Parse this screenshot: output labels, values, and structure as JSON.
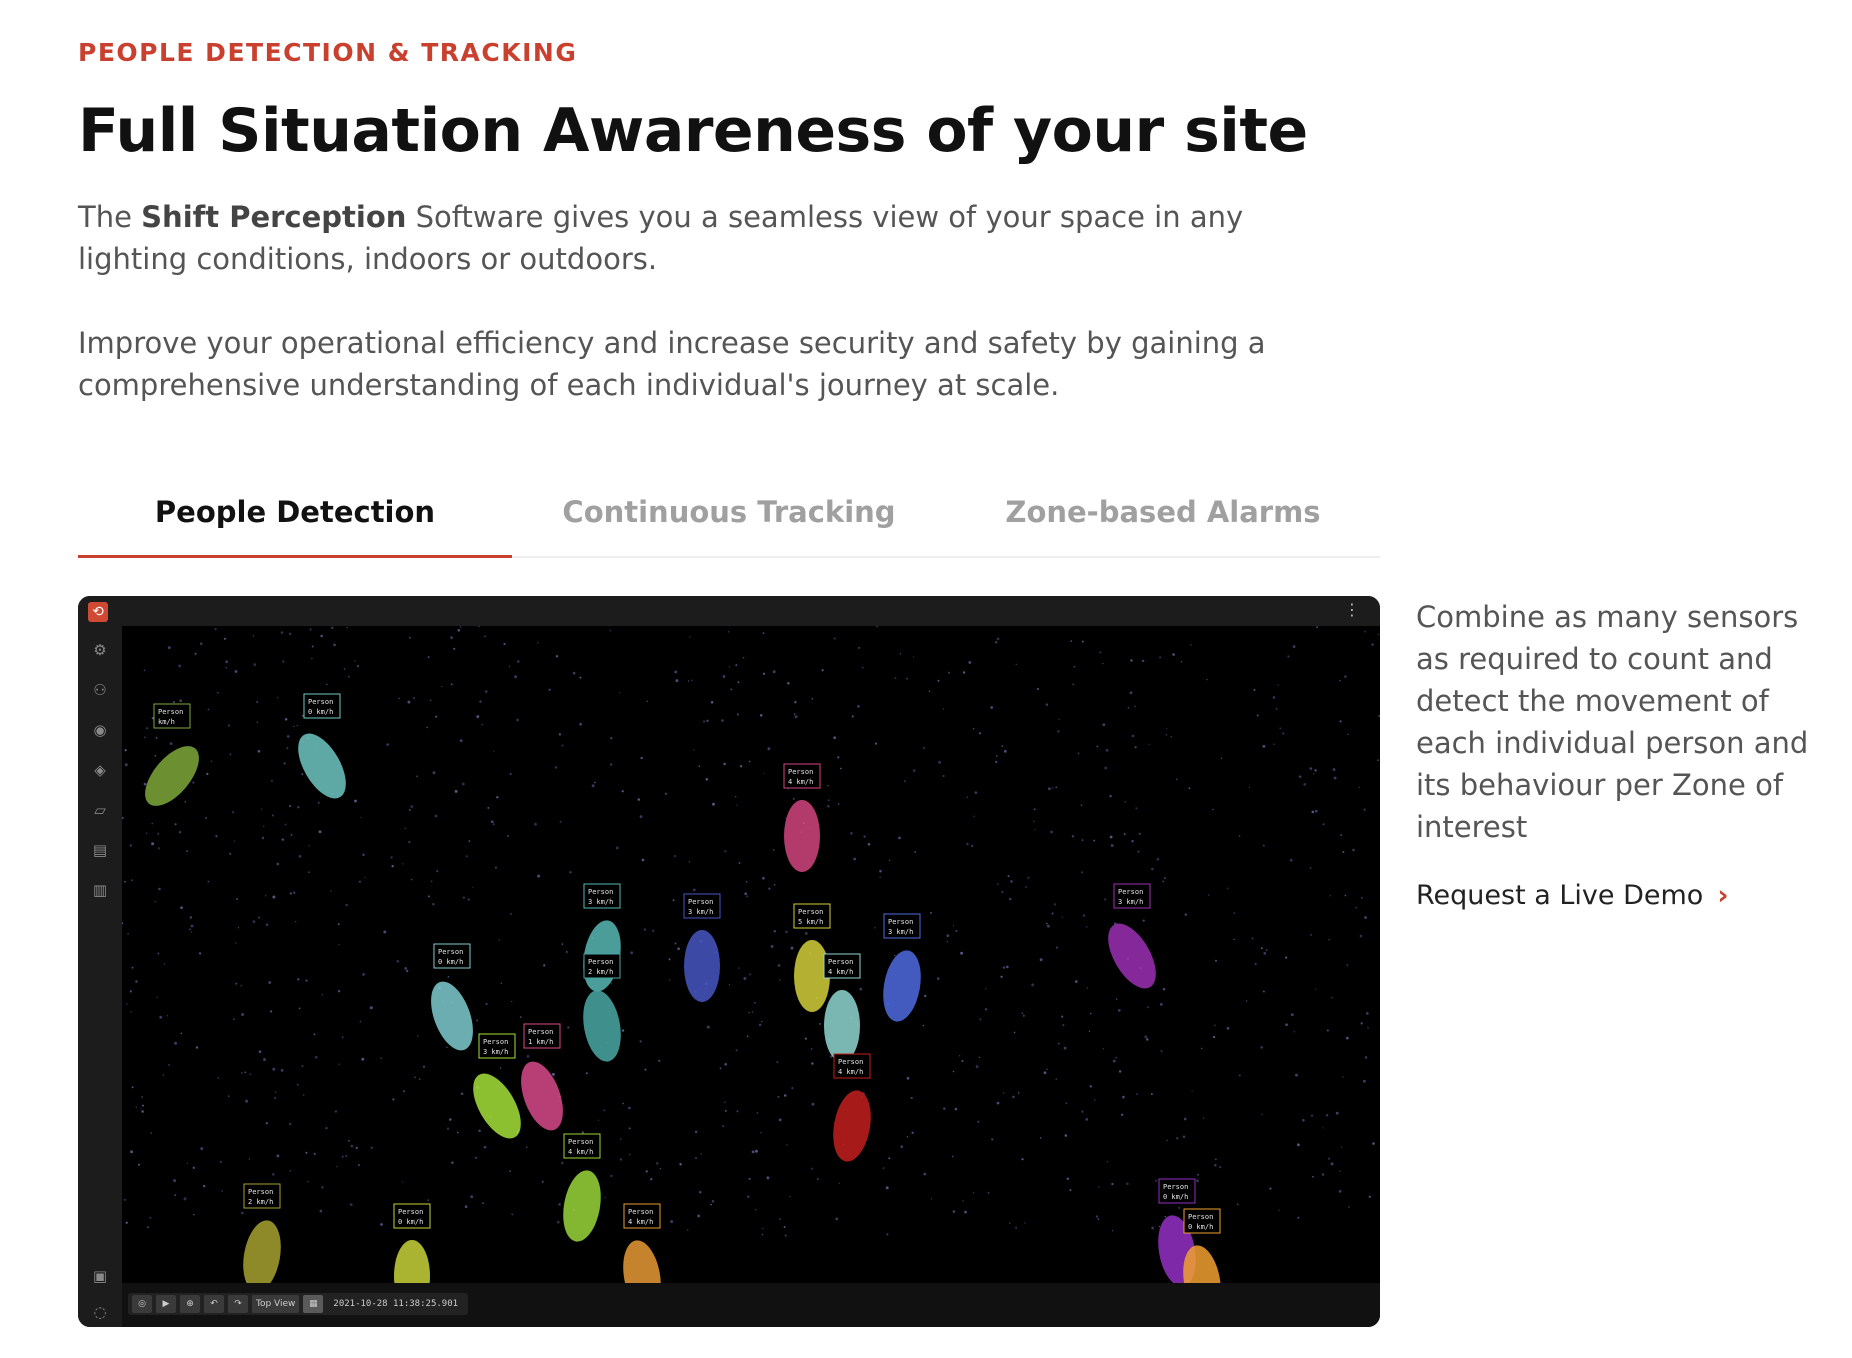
{
  "eyebrow": "PEOPLE DETECTION & TRACKING",
  "headline": "Full Situation Awareness of your site",
  "intro": {
    "prefix": "The ",
    "brand": "Shift Perception",
    "suffix": " Software gives you a seamless view of your space in any lighting conditions, indoors or outdoors."
  },
  "intro2": "Improve your operational efficiency and increase security and safety by gaining a comprehensive understanding of each individual's journey at scale.",
  "tabs": [
    {
      "label": "People Detection",
      "active": true
    },
    {
      "label": "Continuous Tracking",
      "active": false
    },
    {
      "label": "Zone-based Alarms",
      "active": false
    }
  ],
  "viewer": {
    "menu_icon": "kebab-icon",
    "sidebar_icons": [
      "gear-icon",
      "network-icon",
      "sensor-icon",
      "layers-icon",
      "zone-edit-icon",
      "document-icon",
      "map-icon",
      "book-icon",
      "chat-icon"
    ],
    "people": [
      {
        "label": "Person",
        "speed": "0 km/h",
        "color": "#6fc7c2"
      },
      {
        "label": "Person",
        "speed": "km/h",
        "color": "#7fa83a"
      },
      {
        "label": "Person",
        "speed": "4 km/h",
        "color": "#d2457f"
      },
      {
        "label": "Person",
        "speed": "3 km/h",
        "color": "#9b2fb5"
      },
      {
        "label": "Person",
        "speed": "3 km/h",
        "color": "#58b8b4"
      },
      {
        "label": "Person",
        "speed": "3 km/h",
        "color": "#4656c2"
      },
      {
        "label": "Person",
        "speed": "5 km/h",
        "color": "#d4cf3a"
      },
      {
        "label": "Person",
        "speed": "3 km/h",
        "color": "#4f6be0"
      },
      {
        "label": "Person",
        "speed": "2 km/h",
        "color": "#4aa8a4"
      },
      {
        "label": "Person",
        "speed": "4 km/h",
        "color": "#8fd7d2"
      },
      {
        "label": "Person",
        "speed": "0 km/h",
        "color": "#7fcbd0"
      },
      {
        "label": "Person",
        "speed": "1 km/h",
        "color": "#d84a8a"
      },
      {
        "label": "Person",
        "speed": "4 km/h",
        "color": "#c41e1e"
      },
      {
        "label": "Person",
        "speed": "3 km/h",
        "color": "#a6e23a"
      },
      {
        "label": "Person",
        "speed": "4 km/h",
        "color": "#9ad63a"
      },
      {
        "label": "Person",
        "speed": "2 km/h",
        "color": "#a8a230"
      },
      {
        "label": "Person",
        "speed": "0 km/h",
        "color": "#c9d43a"
      },
      {
        "label": "Person",
        "speed": "4 km/h",
        "color": "#e89a35"
      },
      {
        "label": "Person",
        "speed": "0 km/h",
        "color": "#9430c4"
      },
      {
        "label": "Person",
        "speed": "0 km/h",
        "color": "#f0a030"
      }
    ],
    "controls": {
      "view_label": "Top View",
      "timestamp": "2021-10-28 11:38:25.901"
    }
  },
  "sidecopy": "Combine as many sensors as required to count and detect the movement of each individual person and its behaviour per Zone of interest",
  "cta": {
    "label": "Request a Live Demo",
    "icon": "chevron-right-icon"
  },
  "colors": {
    "accent": "#c9402f",
    "viewer_bg": "#000000"
  }
}
